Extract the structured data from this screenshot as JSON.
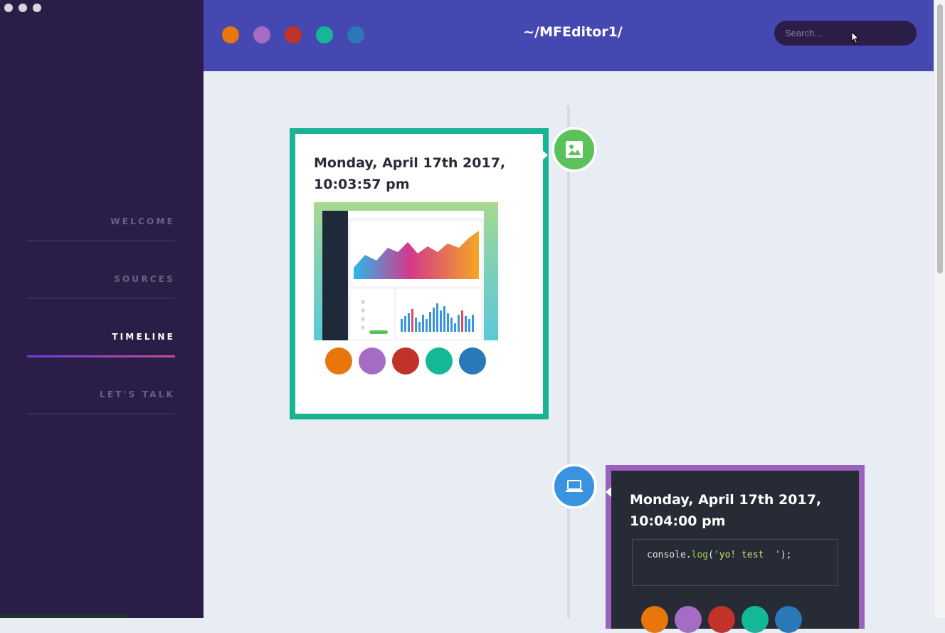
{
  "window": {
    "title": "~/MFEditor1/"
  },
  "colors": {
    "sidebar_bg": "#2a1d48",
    "header_bg": "#4648b2",
    "content_bg": "#e8edf4",
    "palette": [
      "#e8760a",
      "#a66cc4",
      "#c0322a",
      "#14b894",
      "#2b78b8"
    ],
    "card1_border": "#19b394",
    "card2_border": "#9a62bd",
    "node_image": "#5bc25a",
    "node_code": "#3a93de"
  },
  "sidebar": {
    "items": [
      {
        "label": "WELCOME",
        "active": false
      },
      {
        "label": "SOURCES",
        "active": false
      },
      {
        "label": "TIMELINE",
        "active": true
      },
      {
        "label": "LET'S TALK",
        "active": false
      }
    ]
  },
  "header": {
    "title": "~/MFEditor1/",
    "search_placeholder": "Search..."
  },
  "timeline": {
    "entries": [
      {
        "type": "image",
        "icon": "image-icon",
        "date_line1": "Monday, April 17th 2017,",
        "date_line2": "10:03:57 pm"
      },
      {
        "type": "code",
        "icon": "laptop-icon",
        "date_line1": "Monday, April 17th 2017,",
        "date_line2": "10:04:00 pm",
        "code_fn": "console.log",
        "code_open": "(",
        "code_str": "'yo! test  '",
        "code_close": ");"
      }
    ]
  }
}
